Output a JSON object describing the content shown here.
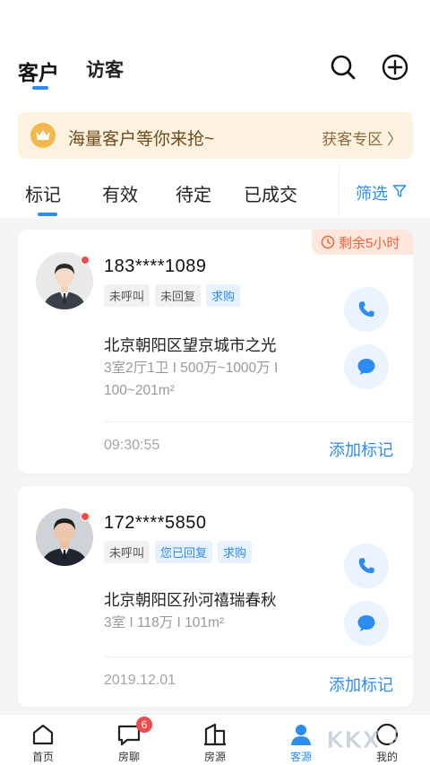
{
  "header": {
    "tabs": [
      {
        "label": "客户"
      },
      {
        "label": "访客"
      }
    ]
  },
  "banner": {
    "text": "海量客户等你来抢~",
    "link": "获客专区 〉"
  },
  "filters": {
    "tabs": [
      {
        "label": "标记"
      },
      {
        "label": "有效"
      },
      {
        "label": "待定"
      },
      {
        "label": "已成交"
      }
    ],
    "filter_label": "筛选"
  },
  "cards": [
    {
      "remaining": "剩余5小时",
      "phone": "183****1089",
      "tags": [
        "未呼叫",
        "未回复",
        "求购"
      ],
      "address": "北京朝阳区望京城市之光",
      "meta": "3室2厅1卫 I 500万~1000万 I 100~201m²",
      "time": "09:30:55",
      "add_mark": "添加标记"
    },
    {
      "phone": "172****5850",
      "tags": [
        "未呼叫",
        "您已回复",
        "求购"
      ],
      "address": "北京朝阳区孙河禧瑞春秋",
      "meta": "3室 I 118万 I 101m²",
      "time": "2019.12.01",
      "add_mark": "添加标记"
    }
  ],
  "bottom_nav": {
    "items": [
      {
        "label": "首页",
        "icon": "home-icon"
      },
      {
        "label": "房聊",
        "icon": "chat-icon",
        "badge": "6"
      },
      {
        "label": "房源",
        "icon": "building-icon"
      },
      {
        "label": "客源",
        "icon": "person-icon",
        "active": true
      },
      {
        "label": "我的",
        "icon": "profile-icon"
      }
    ]
  },
  "watermark": "KKX下载",
  "colors": {
    "accent": "#2d8cf0",
    "warning": "#e8663d",
    "badge": "#f04a4a",
    "banner_bg": "#fdf1df"
  }
}
